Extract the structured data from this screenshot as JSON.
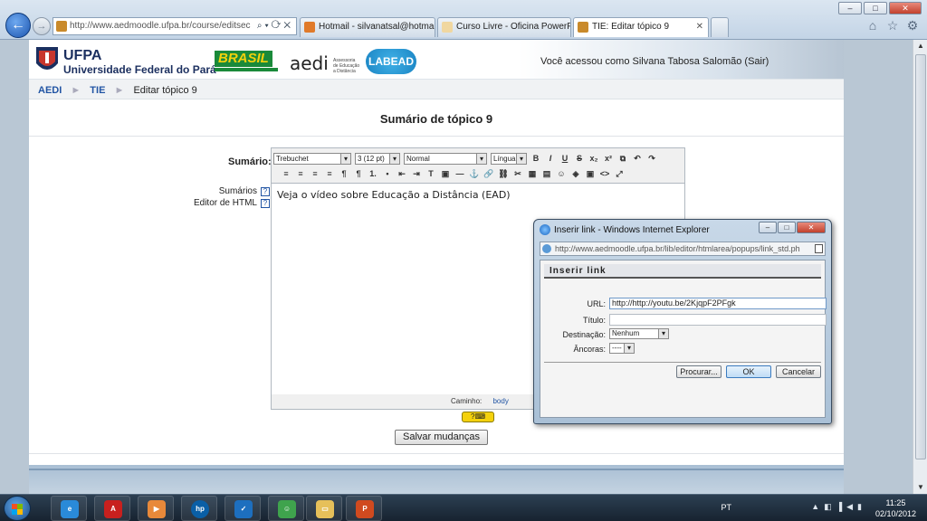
{
  "browser": {
    "address": "http://www.aedmoodle.ufpa.br/course/editsec",
    "tabs": [
      {
        "label": "Hotmail - silvanatsal@hotmail....",
        "active": false
      },
      {
        "label": "Curso Livre - Oficina PowerPoi...",
        "active": false
      },
      {
        "label": "TIE: Editar tópico 9",
        "active": true
      }
    ],
    "window_controls": {
      "minimize": "–",
      "maximize": "□",
      "close": "✕"
    }
  },
  "site": {
    "ufpa_name": "UFPA",
    "ufpa_full": "Universidade Federal do Pará",
    "brasil_logo": "BRASIL",
    "aedi_logo": "aedi",
    "aedi_sub": "Assessoria de Educação a Distância",
    "labead_logo": "LABEAD",
    "login_text": "Você acessou como Silvana Tabosa Salomão (Sair)"
  },
  "breadcrumb": {
    "items": [
      "AEDI",
      "TIE"
    ],
    "current": "Editar tópico 9",
    "separator": "►"
  },
  "page": {
    "title": "Sumário de tópico 9",
    "summary_label": "Sumário:",
    "help_summaries": "Sumários",
    "help_html_editor": "Editor de HTML",
    "help_mark": "?",
    "save_button": "Salvar mudanças"
  },
  "editor": {
    "font": "Trebuchet",
    "size": "3 (12 pt)",
    "style": "Normal",
    "language": "Língua",
    "content": "Veja o vídeo sobre Educação a Distância (EAD)",
    "path_label": "Caminho:",
    "path_value": "body",
    "toolbar_row1": [
      "B",
      "I",
      "U",
      "S",
      "x₂",
      "x²",
      "⧉",
      "↶",
      "↷"
    ],
    "toolbar_row2": [
      "≡",
      "≡",
      "≡",
      "≡",
      "¶",
      "¶",
      "1.",
      "•",
      "⇤",
      "⇥",
      "T",
      "▣",
      "—",
      "⚓",
      "🔗",
      "⛓",
      "✂",
      "▦",
      "▤",
      "☺",
      "◈",
      "▣",
      "<>",
      "⤢"
    ]
  },
  "dialog": {
    "title": "Inserir link - Windows Internet Explorer",
    "address": "http://www.aedmoodle.ufpa.br/lib/editor/htmlarea/popups/link_std.ph",
    "heading": "Inserir link",
    "url_label": "URL:",
    "url_value": "http://http://youtu.be/2KjqpF2PFgk",
    "title_label": "Título:",
    "title_value": "",
    "target_label": "Destinação:",
    "target_value": "Nenhum",
    "anchors_label": "Âncoras:",
    "anchors_value": "----",
    "browse_button": "Procurar...",
    "ok_button": "OK",
    "cancel_button": "Cancelar"
  },
  "taskbar": {
    "language": "PT",
    "time": "11:25",
    "date": "02/10/2012"
  }
}
